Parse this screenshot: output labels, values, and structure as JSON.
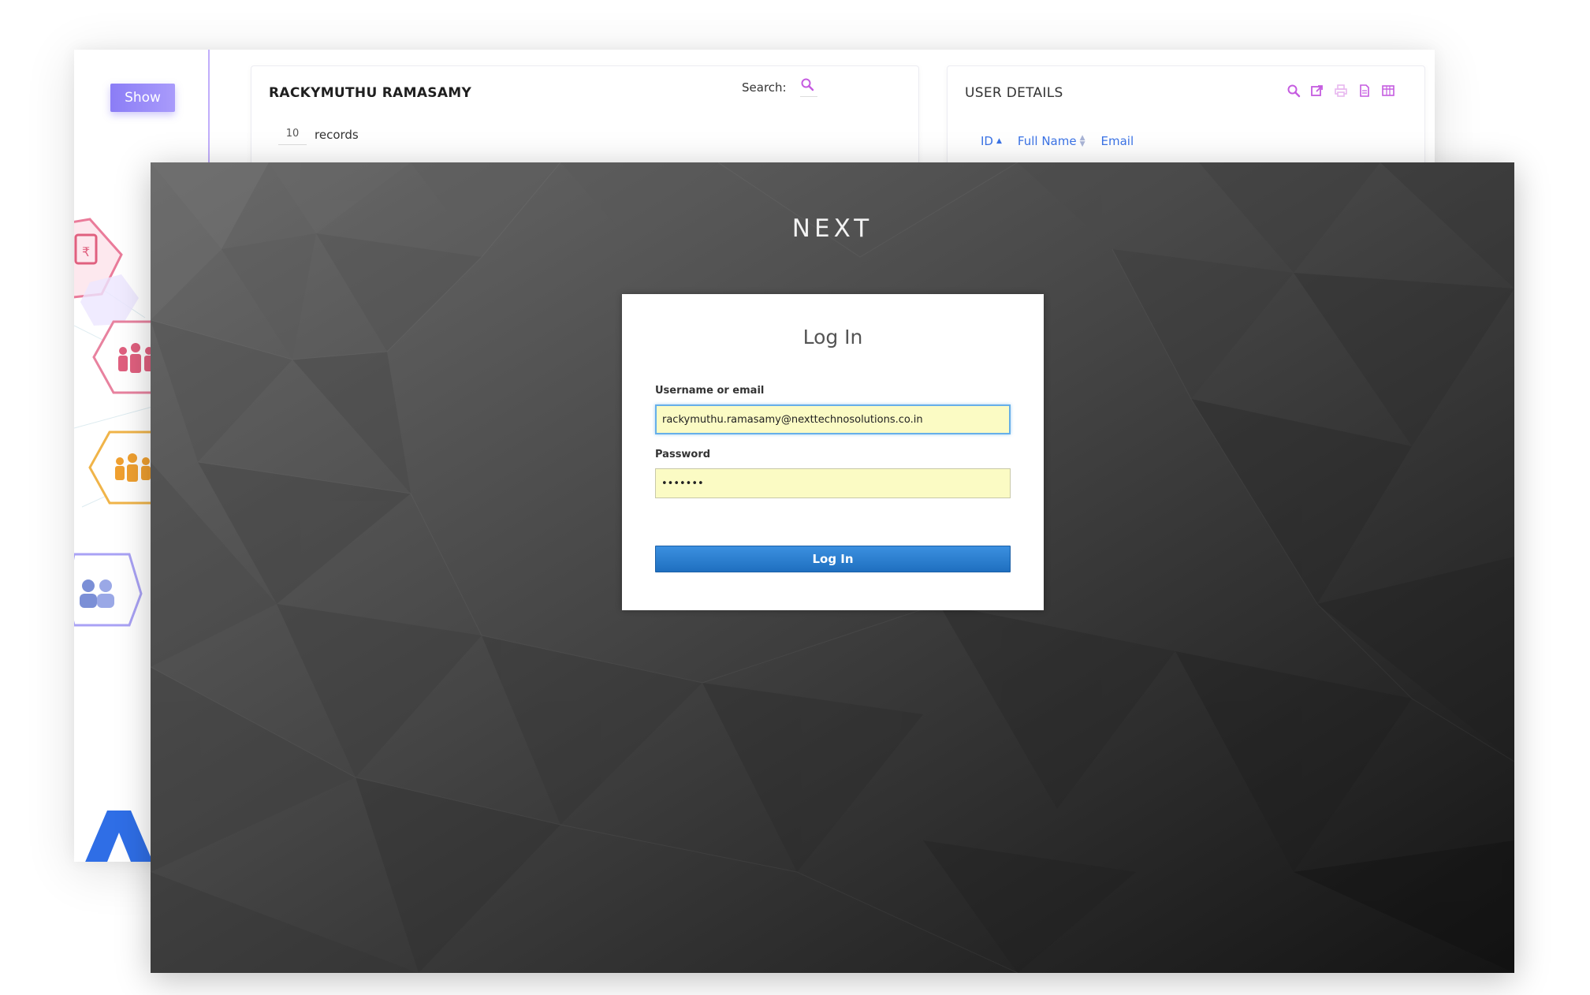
{
  "dashboard": {
    "show_button": "Show",
    "left_panel": {
      "title": "RACKYMUTHU RAMASAMY",
      "search_label": "Search:",
      "records_count": "10",
      "records_label": "records"
    },
    "right_panel": {
      "title": "USER DETAILS",
      "tool_icons": [
        "search-icon",
        "export-icon",
        "print-icon",
        "document-icon",
        "columns-icon"
      ],
      "columns": [
        "ID",
        "Full Name",
        "Email"
      ]
    },
    "accent_color": "#8b7df6",
    "link_color": "#3b73e6"
  },
  "login": {
    "brand": "NEXT",
    "heading": "Log In",
    "username_label": "Username or email",
    "username_value": "rackymuthu.ramasamy@nexttechnosolutions.co.in",
    "password_label": "Password",
    "password_value": "•••••••",
    "submit_label": "Log In",
    "button_color": "#2a7fd4",
    "field_bg": "#fbfbc4"
  }
}
